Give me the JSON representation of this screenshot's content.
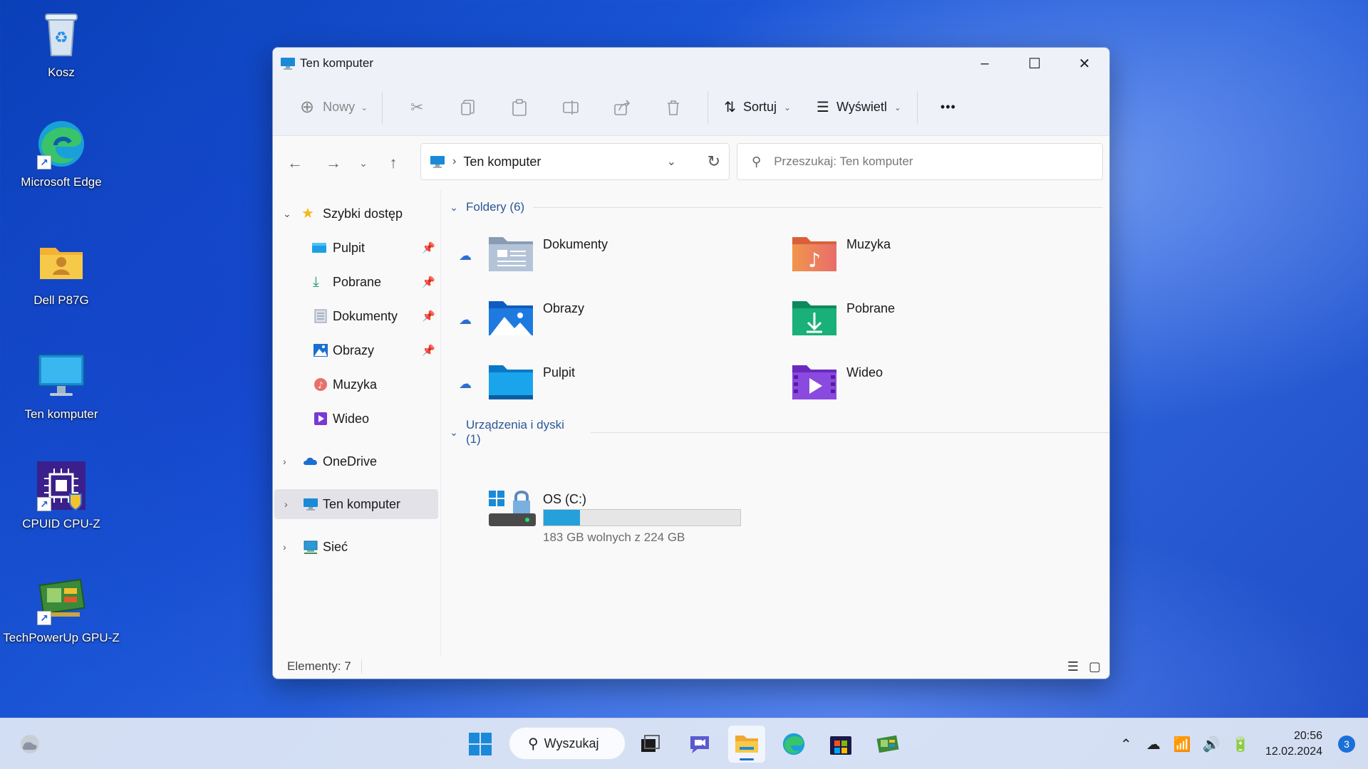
{
  "desktop": {
    "icons": [
      {
        "label": "Kosz",
        "icon": "recycle-bin-icon"
      },
      {
        "label": "Microsoft Edge",
        "icon": "edge-icon"
      },
      {
        "label": "Dell P87G",
        "icon": "user-folder-icon"
      },
      {
        "label": "Ten komputer",
        "icon": "monitor-icon"
      },
      {
        "label": "CPUID CPU-Z",
        "icon": "cpuz-icon"
      },
      {
        "label": "TechPowerUp GPU-Z",
        "icon": "gpuz-icon"
      }
    ]
  },
  "window": {
    "title": "Ten komputer",
    "toolbar": {
      "new_label": "Nowy",
      "sort_label": "Sortuj",
      "view_label": "Wyświetl",
      "more_label": "•••"
    },
    "address": {
      "location": "Ten komputer",
      "separator": "›"
    },
    "search": {
      "placeholder": "Przeszukaj: Ten komputer"
    },
    "nav": {
      "quick_access": "Szybki dostęp",
      "items": [
        {
          "label": "Pulpit",
          "pinned": true
        },
        {
          "label": "Pobrane",
          "pinned": true
        },
        {
          "label": "Dokumenty",
          "pinned": true
        },
        {
          "label": "Obrazy",
          "pinned": true
        },
        {
          "label": "Muzyka",
          "pinned": false
        },
        {
          "label": "Wideo",
          "pinned": false
        }
      ],
      "onedrive": "OneDrive",
      "this_pc": "Ten komputer",
      "network": "Sieć"
    },
    "content": {
      "folders_header": "Foldery (6)",
      "folders": [
        {
          "name": "Dokumenty",
          "cloud": true
        },
        {
          "name": "Muzyka",
          "cloud": false
        },
        {
          "name": "Obrazy",
          "cloud": true
        },
        {
          "name": "Pobrane",
          "cloud": false
        },
        {
          "name": "Pulpit",
          "cloud": true
        },
        {
          "name": "Wideo",
          "cloud": false
        }
      ],
      "devices_header": "Urządzenia i dyski (1)",
      "drive": {
        "name": "OS (C:)",
        "info": "183 GB wolnych z 224 GB",
        "used_fraction": 0.183
      }
    },
    "status": {
      "items_count": "Elementy: 7"
    }
  },
  "taskbar": {
    "search_label": "Wyszukaj",
    "time": "20:56",
    "date": "12.02.2024",
    "notifications": "3"
  },
  "colors": {
    "accent": "#1c6fd6",
    "drive_bar": "#26a0da",
    "group_header": "#2b5797"
  }
}
